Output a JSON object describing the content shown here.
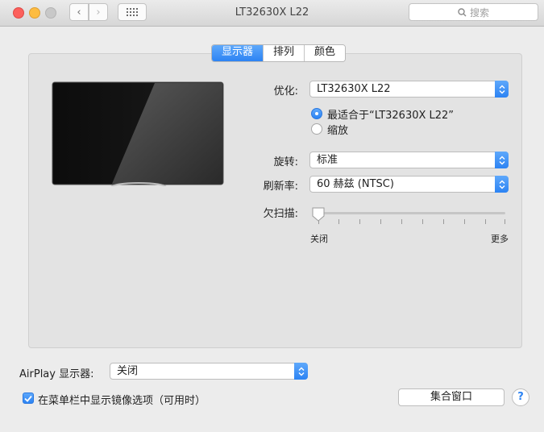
{
  "window": {
    "title": "LT32630X  L22"
  },
  "toolbar": {
    "search_placeholder": "搜索",
    "back_glyph": "‹",
    "forward_glyph": "›"
  },
  "tabs": [
    {
      "label": "显示器",
      "active": true
    },
    {
      "label": "排列",
      "active": false
    },
    {
      "label": "颜色",
      "active": false
    }
  ],
  "optimize": {
    "label": "优化:",
    "value": "LT32630X  L22",
    "options": [
      {
        "label": "最适合于“LT32630X  L22”",
        "selected": true
      },
      {
        "label": "缩放",
        "selected": false
      }
    ]
  },
  "rotation": {
    "label": "旋转:",
    "value": "标准"
  },
  "refresh": {
    "label": "刷新率:",
    "value": "60 赫兹 (NTSC)"
  },
  "underscan": {
    "label": "欠扫描:",
    "min_label": "关闭",
    "max_label": "更多",
    "level": 0
  },
  "airplay": {
    "label": "AirPlay 显示器:",
    "value": "关闭"
  },
  "mirror_option": {
    "label": "在菜单栏中显示镜像选项（可用时）",
    "checked": true
  },
  "gather_button": {
    "label": "集合窗口"
  },
  "help": {
    "label": "?"
  },
  "colors": {
    "accent": "#2c83f3",
    "close": "#fc605c",
    "minimize": "#fdbc40"
  },
  "icons": [
    "close-icon",
    "minimize-icon",
    "zoom-icon",
    "chevron-left-icon",
    "chevron-right-icon",
    "grid-icon",
    "search-icon",
    "monitor-icon",
    "updown-arrows-icon",
    "checkmark-icon"
  ]
}
